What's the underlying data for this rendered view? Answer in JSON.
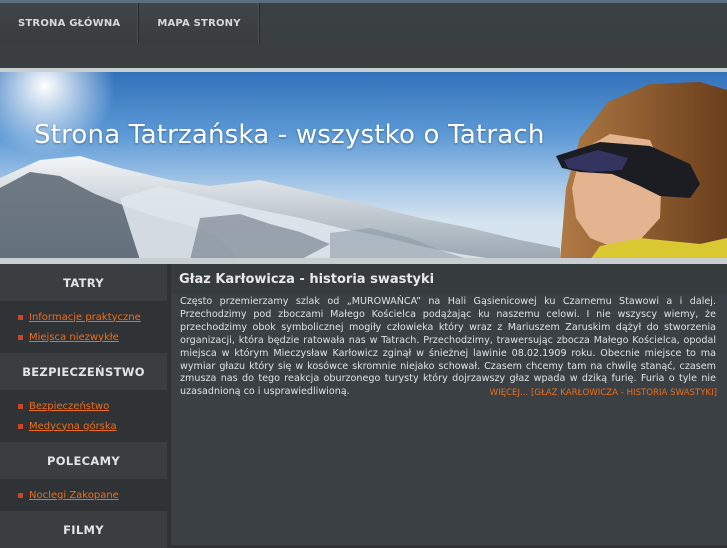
{
  "nav": {
    "items": [
      {
        "label": "STRONA GŁÓWNA"
      },
      {
        "label": "MAPA STRONY"
      }
    ]
  },
  "banner": {
    "title": "Strona Tatrzańska - wszystko o Tatrach"
  },
  "sidebar": {
    "sections": [
      {
        "heading": "TATRY",
        "links": [
          "Informacje praktyczne",
          "Miejsca niezwykłe"
        ]
      },
      {
        "heading": "BEZPIECZEŃSTWO",
        "links": [
          "Bezpieczeństwo",
          "Medycyna górska"
        ]
      },
      {
        "heading": "POLECAMY",
        "links": [
          "Noclegi Zakopane"
        ]
      },
      {
        "heading": "FILMY",
        "links": []
      }
    ]
  },
  "article": {
    "title": "Głaz Karłowicza - historia swastyki",
    "body": "Często przemierzamy szlak od „MUROWAŃCA” na Hali Gąsienicowej ku Czarnemu Stawowi a i dalej. Przechodzimy pod zboczami Małego Kościelca podążając ku naszemu celowi. I nie wszyscy wiemy, że przechodzimy obok symbolicznej mogiły człowieka który wraz z Mariuszem Zaruskim dążył do stworzenia organizacji, która będzie ratowała nas w Tatrach. Przechodzimy, trawersując zbocza Małego Kościelca, opodal miejsca w którym Mieczysław Karłowicz zginął w śnieżnej lawinie 08.02.1909 roku. Obecnie miejsce to ma wymiar głazu który się w kosówce skromnie niejako schował. Czasem chcemy tam na chwilę stanąć, czasem zmusza nas do tego reakcja oburzonego turysty który dojrzawszy głaz wpada w dziką furię. Furia o tyle nie uzasadnioną co i usprawiedliwioną.",
    "more": "WIĘCEJ... [GŁAZ KARŁOWICZA - HISTORIA SWASTYKI]"
  },
  "colors": {
    "link": "#ef6d1a",
    "bullet": "#c8452c",
    "background": "#2f3336"
  }
}
